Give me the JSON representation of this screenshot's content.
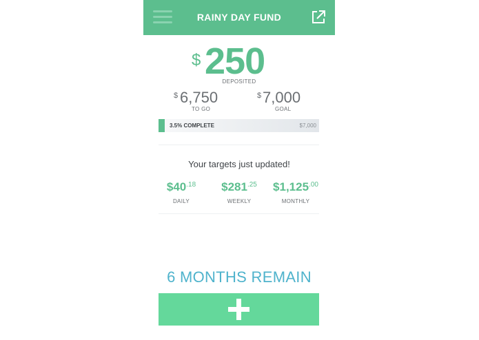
{
  "header": {
    "title": "RAINY DAY FUND",
    "menu_icon": "hamburger-menu-icon",
    "share_icon": "external-link-icon"
  },
  "deposit": {
    "currency": "$",
    "amount": "250",
    "label": "DEPOSITED"
  },
  "to_go": {
    "currency": "$",
    "amount": "6,750",
    "label": "TO GO"
  },
  "goal": {
    "currency": "$",
    "amount": "7,000",
    "label": "GOAL"
  },
  "progress": {
    "percent": 3.5,
    "label": "3.5% COMPLETE",
    "goal_label": "$7,000"
  },
  "notice": "Your targets just updated!",
  "targets": [
    {
      "dollars": "$40",
      "cents": ".18",
      "label": "DAILY"
    },
    {
      "dollars": "$281",
      "cents": ".25",
      "label": "WEEKLY"
    },
    {
      "dollars": "$1,125",
      "cents": ".00",
      "label": "MONTHLY"
    }
  ],
  "remaining": "6 MONTHS REMAIN",
  "add_button": {
    "icon": "plus-icon"
  },
  "colors": {
    "brand_green": "#5cbe8e",
    "button_green": "#64d89b",
    "remain_blue": "#4fb3cc",
    "text_gray": "#6b6f73"
  }
}
